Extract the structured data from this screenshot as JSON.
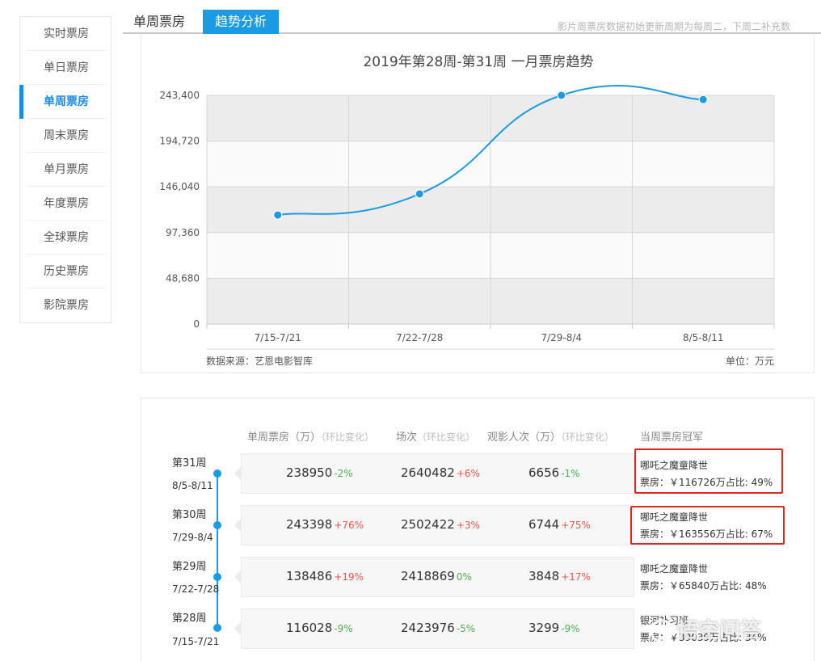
{
  "sidebar": {
    "items": [
      {
        "label": "实时票房"
      },
      {
        "label": "单日票房"
      },
      {
        "label": "单周票房"
      },
      {
        "label": "周末票房"
      },
      {
        "label": "单月票房"
      },
      {
        "label": "年度票房"
      },
      {
        "label": "全球票房"
      },
      {
        "label": "历史票房"
      },
      {
        "label": "影院票房"
      }
    ],
    "active_index": 2
  },
  "tabs": {
    "weekly": "单周票房",
    "trend": "趋势分析"
  },
  "notice": "影片周票房数据初始更新周期为每周二，下周二补充数",
  "chart_data": {
    "type": "line",
    "title": "2019年第28周-第31周  一月票房趋势",
    "categories": [
      "7/15-7/21",
      "7/22-7/28",
      "7/29-8/4",
      "8/5-8/11"
    ],
    "values": [
      116028,
      138486,
      243398,
      238950
    ],
    "yticks": [
      "0",
      "48,680",
      "97,360",
      "146,040",
      "194,720",
      "243,400"
    ],
    "ylim": [
      0,
      243400
    ],
    "grid": true,
    "source": "数据来源：艺恩电影智库",
    "unit": "单位：万元",
    "line_color": "#1a9be3"
  },
  "table": {
    "headers": [
      {
        "main": "单周票房（万）",
        "sub": "（环比变化）"
      },
      {
        "main": "场次",
        "sub": "（环比变化）"
      },
      {
        "main": "观影人次（万）",
        "sub": "（环比变化）"
      },
      {
        "main": "当周票房冠军",
        "sub": ""
      }
    ],
    "rows": [
      {
        "week": "第31周",
        "range": "8/5-8/11",
        "box": "238950",
        "box_chg": "-2%",
        "box_dir": "down",
        "shows": "2640482",
        "shows_chg": "+6%",
        "shows_dir": "up",
        "viewers": "6656",
        "viewers_chg": "-1%",
        "viewers_dir": "down",
        "champ": "哪吒之魔童降世",
        "champ_info": "票房：￥116726万占比: 49%",
        "highlight": true
      },
      {
        "week": "第30周",
        "range": "7/29-8/4",
        "box": "243398",
        "box_chg": "+76%",
        "box_dir": "up",
        "shows": "2502422",
        "shows_chg": "+3%",
        "shows_dir": "up",
        "viewers": "6744",
        "viewers_chg": "+75%",
        "viewers_dir": "up",
        "champ": "哪吒之魔童降世",
        "champ_info": "票房：￥163556万占比: 67%",
        "highlight": true
      },
      {
        "week": "第29周",
        "range": "7/22-7/28",
        "box": "138486",
        "box_chg": "+19%",
        "box_dir": "up",
        "shows": "2418869",
        "shows_chg": "0%",
        "shows_dir": "down",
        "viewers": "3848",
        "viewers_chg": "+17%",
        "viewers_dir": "up",
        "champ": "哪吒之魔童降世",
        "champ_info": "票房：￥65840万占比: 48%",
        "highlight": false
      },
      {
        "week": "第28周",
        "range": "7/15-7/21",
        "box": "116028",
        "box_chg": "-9%",
        "box_dir": "down",
        "shows": "2423976",
        "shows_chg": "-5%",
        "shows_dir": "down",
        "viewers": "3299",
        "viewers_chg": "-9%",
        "viewers_dir": "down",
        "champ": "银河补习班",
        "champ_info": "票房：￥39039万占比: 34%",
        "highlight": false
      }
    ]
  },
  "watermark": "悟空问答"
}
